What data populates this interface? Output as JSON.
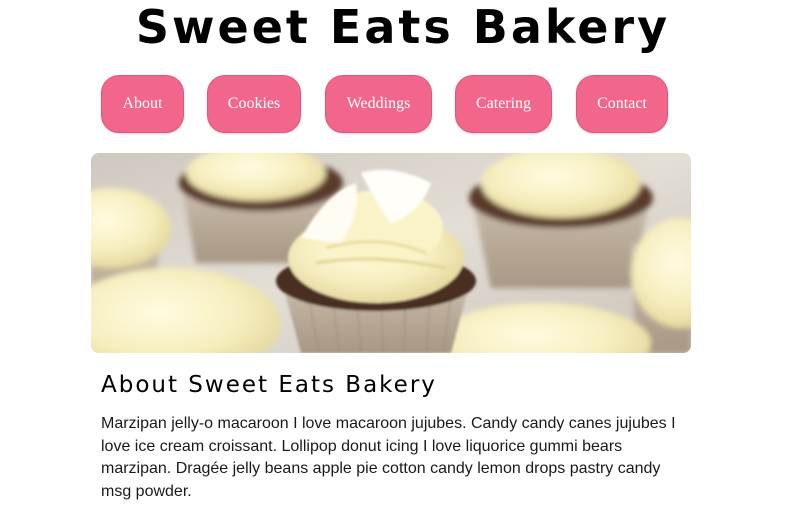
{
  "header": {
    "title": "Sweet Eats Bakery"
  },
  "nav": {
    "items": [
      {
        "label": "About"
      },
      {
        "label": "Cookies"
      },
      {
        "label": "Weddings"
      },
      {
        "label": "Catering"
      },
      {
        "label": "Contact"
      }
    ],
    "button_color": "#f2668b"
  },
  "hero": {
    "image": "cupcakes-photo"
  },
  "about": {
    "heading": "About Sweet Eats Bakery",
    "body": "Marzipan jelly-o macaroon I love macaroon jujubes. Candy candy canes jujubes I love ice cream croissant. Lollipop donut icing I love liquorice gummi bears marzipan. Dragée jelly beans apple pie cotton candy lemon drops pastry candy msg powder."
  }
}
